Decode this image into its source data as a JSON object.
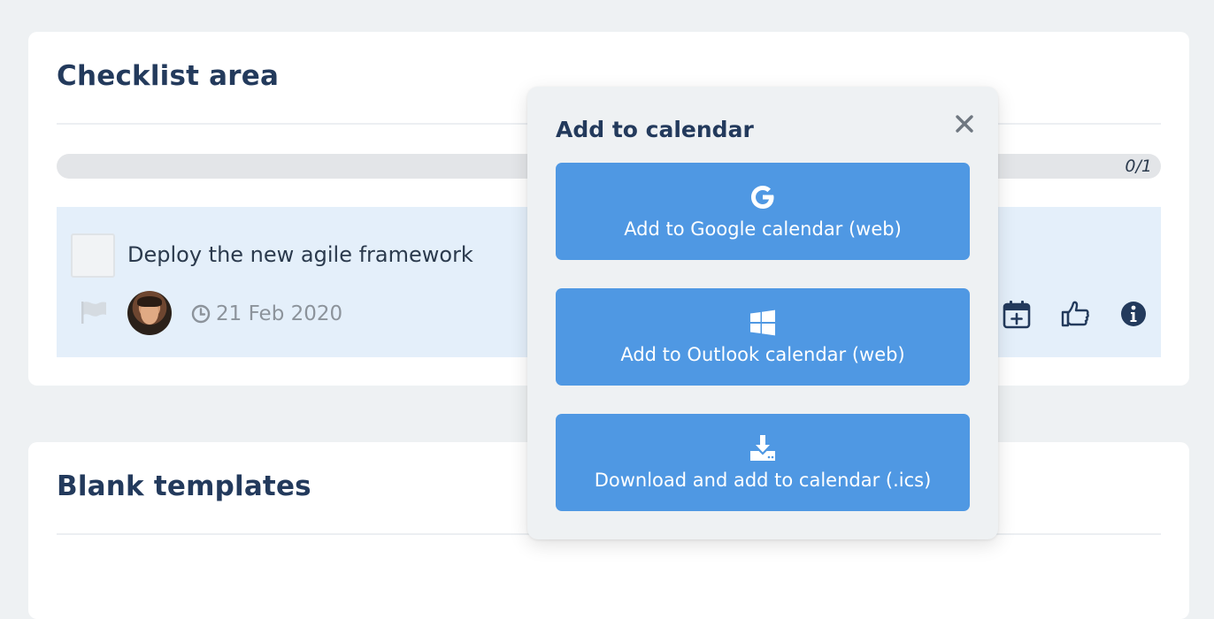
{
  "checklist_card": {
    "title": "Checklist area",
    "progress": {
      "text": "0/1",
      "completed": 0,
      "total": 1
    },
    "task": {
      "title": "Deploy the new agile framework",
      "due_date": "21 Feb 2020",
      "icons": [
        "flag-icon",
        "clock-icon",
        "calendar-add-icon",
        "thumbs-up-icon",
        "info-icon"
      ]
    }
  },
  "templates_card": {
    "title": "Blank templates"
  },
  "calendar_popup": {
    "title": "Add to calendar",
    "close_icon": "close-icon",
    "buttons": [
      {
        "label": "Add to Google calendar (web)",
        "icon": "google-icon"
      },
      {
        "label": "Add to Outlook calendar (web)",
        "icon": "windows-icon"
      },
      {
        "label": "Download and add to calendar (.ics)",
        "icon": "download-icon"
      }
    ]
  },
  "colors": {
    "page_background": "#eef1f3",
    "heading": "#233a5c",
    "button_blue": "#4f98e3",
    "task_row_background": "#e4effa"
  }
}
